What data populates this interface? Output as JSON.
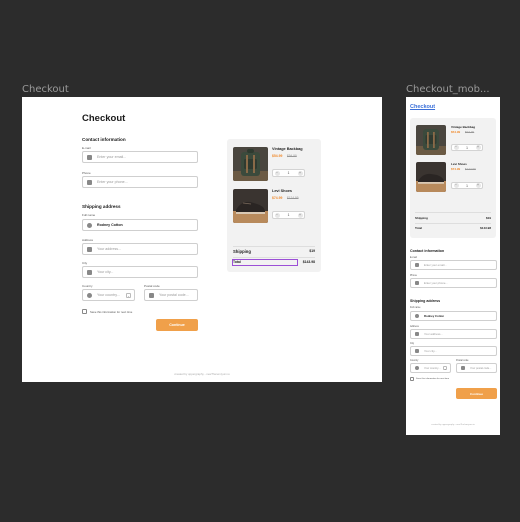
{
  "frames": {
    "desktop_label": "Checkout",
    "mobile_label": "Checkout_mob..."
  },
  "checkout": {
    "title": "Checkout",
    "contact": {
      "heading": "Contact information",
      "email_label": "E-mail",
      "email_placeholder": "Enter your email...",
      "phone_label": "Phone",
      "phone_placeholder": "Enter your phone..."
    },
    "shipping": {
      "heading": "Shipping address",
      "fullname_label": "Full name",
      "fullname_value": "Rodney Cotton",
      "address_label": "Address",
      "address_placeholder": "Your address...",
      "city_label": "City",
      "city_placeholder": "Your city...",
      "country_label": "Country",
      "country_placeholder": "Your country...",
      "postal_label": "Postal code",
      "postal_placeholder": "Your postal code...",
      "save_label": "Save this information for next time"
    },
    "continue_label": "Continue",
    "footer": "created by uppergraphy - newThe/emiyum.io"
  },
  "cart": {
    "items": [
      {
        "name": "Vintage Backbag",
        "price": "$54.99",
        "old_price": "$94.99",
        "qty": "1",
        "image": "backpack-photo"
      },
      {
        "name": "Levi Shoes",
        "price": "$74.99",
        "old_price": "$124.99",
        "qty": "1",
        "image": "shoes-photo"
      }
    ],
    "shipping_label": "Shipping",
    "shipping_value": "$19",
    "total_label": "Total",
    "total_value": "$143.98"
  },
  "colors": {
    "accent": "#f0a04a",
    "price": "#f08a2c",
    "selection": "#9b4fd6",
    "mobile_title": "#3a6fd8",
    "canvas": "#2c2c2c"
  }
}
